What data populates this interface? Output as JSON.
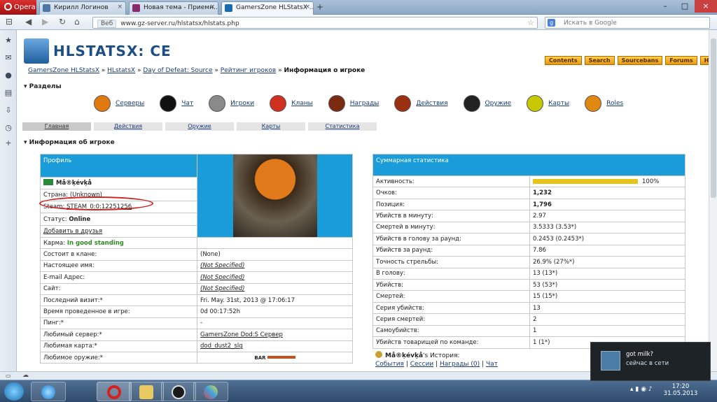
{
  "browser": {
    "menu_label": "Opera",
    "tabs": [
      {
        "title": "Кирилл Логинов"
      },
      {
        "title": "Новая тема - Приемн..."
      },
      {
        "title": "GamersZone HLStatsX ..."
      }
    ],
    "address_badge": "Веб",
    "url": "www.gz-server.ru/hlstatsx/hlstats.php",
    "search_placeholder": "Искать в Google"
  },
  "site": {
    "logo_text": "HLSTATSX: CE",
    "toplinks": [
      "Contents",
      "Search",
      "Sourcebans",
      "Forums",
      "Help"
    ],
    "breadcrumb": {
      "items": [
        "GamersZone HLStatsX",
        "HLstatsX",
        "Day of Defeat: Source",
        "Рейтинг игроков"
      ],
      "separator": "»",
      "current": "Информация о игроке"
    },
    "sections_title": "Разделы",
    "nav": [
      {
        "label": "Серверы",
        "color": "#e07a10"
      },
      {
        "label": "Чат",
        "color": "#111111"
      },
      {
        "label": "Игроки",
        "color": "#8a8a8a"
      },
      {
        "label": "Кланы",
        "color": "#d03020"
      },
      {
        "label": "Награды",
        "color": "#7a2a10"
      },
      {
        "label": "Действия",
        "color": "#9a3010"
      },
      {
        "label": "Оружие",
        "color": "#222222"
      },
      {
        "label": "Карты",
        "color": "#c8c800"
      },
      {
        "label": "Roles",
        "color": "#e08810"
      }
    ],
    "subtabs": [
      "Главная",
      "Действия",
      "Оружие",
      "Карты",
      "Статистика"
    ],
    "player_info_title": "Информация об игроке"
  },
  "profile": {
    "header": "Профиль",
    "name": "Må®ķévķå",
    "country": "Страна: (Unknown)",
    "steam_label": "Steam:",
    "steam_id": "STEAM_0:0:12251256",
    "status_label": "Статус:",
    "status_value": "Online",
    "add_friend": "Добавить в друзья",
    "karma_label": "Карма:",
    "karma_value": "In good standing",
    "rows": [
      {
        "label": "Состоит в клане:",
        "value": "(None)",
        "link": false
      },
      {
        "label": "Настоящее имя:",
        "value": "(Not Specified)",
        "link": true
      },
      {
        "label": "E-mail Адрес:",
        "value": "(Not Specified)",
        "link": true
      },
      {
        "label": "Сайт:",
        "value": "(Not Specified)",
        "link": true
      },
      {
        "label": "Последний визит:*",
        "value": "Fri. May. 31st, 2013 @ 17:06:17",
        "link": false
      },
      {
        "label": "Время проведенное в игре:",
        "value": "0d 00:17:52h",
        "link": false
      },
      {
        "label": "Пинг:*",
        "value": "-",
        "link": false
      },
      {
        "label": "Любимый сервер:*",
        "value": "GamersZone Dod:S Сервер",
        "link": true
      },
      {
        "label": "Любимая карта:*",
        "value": "dod_dust2_slg",
        "link": true
      },
      {
        "label": "Любимое оружие:*",
        "value": "BAR",
        "link": false
      }
    ]
  },
  "stats": {
    "header": "Суммарная статистика",
    "activity_label": "Активность:",
    "activity_value": "100%",
    "activity_fraction": 1.0,
    "rows": [
      {
        "label": "Очков:",
        "value": "1,232",
        "bold": true
      },
      {
        "label": "Позиция:",
        "value": "1,796",
        "bold": true
      },
      {
        "label": "Убийств в минуту:",
        "value": "2.97",
        "bold": false
      },
      {
        "label": "Смертей в минуту:",
        "value": "3.5333 (3.53*)",
        "bold": false
      },
      {
        "label": "Убийств в голову за раунд:",
        "value": "0.2453 (0.2453*)",
        "bold": false
      },
      {
        "label": "Убийств за раунд:",
        "value": "7.86",
        "bold": false
      },
      {
        "label": "Точность стрельбы:",
        "value": "26.9% (27%*)",
        "bold": false
      },
      {
        "label": "В голову:",
        "value": "13 (13*)",
        "bold": false
      },
      {
        "label": "Убийств:",
        "value": "53 (53*)",
        "bold": false
      },
      {
        "label": "Смертей:",
        "value": "15 (15*)",
        "bold": false
      },
      {
        "label": "Серия убийств:",
        "value": "13",
        "bold": false
      },
      {
        "label": "Серия смертей:",
        "value": "2",
        "bold": false
      },
      {
        "label": "Самоубийств:",
        "value": "1",
        "bold": false
      },
      {
        "label": "Убийств товарищей по команде:",
        "value": "1 (1*)",
        "bold": false
      }
    ]
  },
  "history": {
    "name": "Må®ķévķå",
    "suffix": "'s История:",
    "links": [
      "События",
      "Сессии",
      "Награды (0)",
      "Чат"
    ],
    "separator": "|"
  },
  "notification": {
    "title": "got milk?",
    "text": "сейчас в сети"
  },
  "taskbar": {
    "time": "17:20",
    "date": "31.05.2013"
  }
}
